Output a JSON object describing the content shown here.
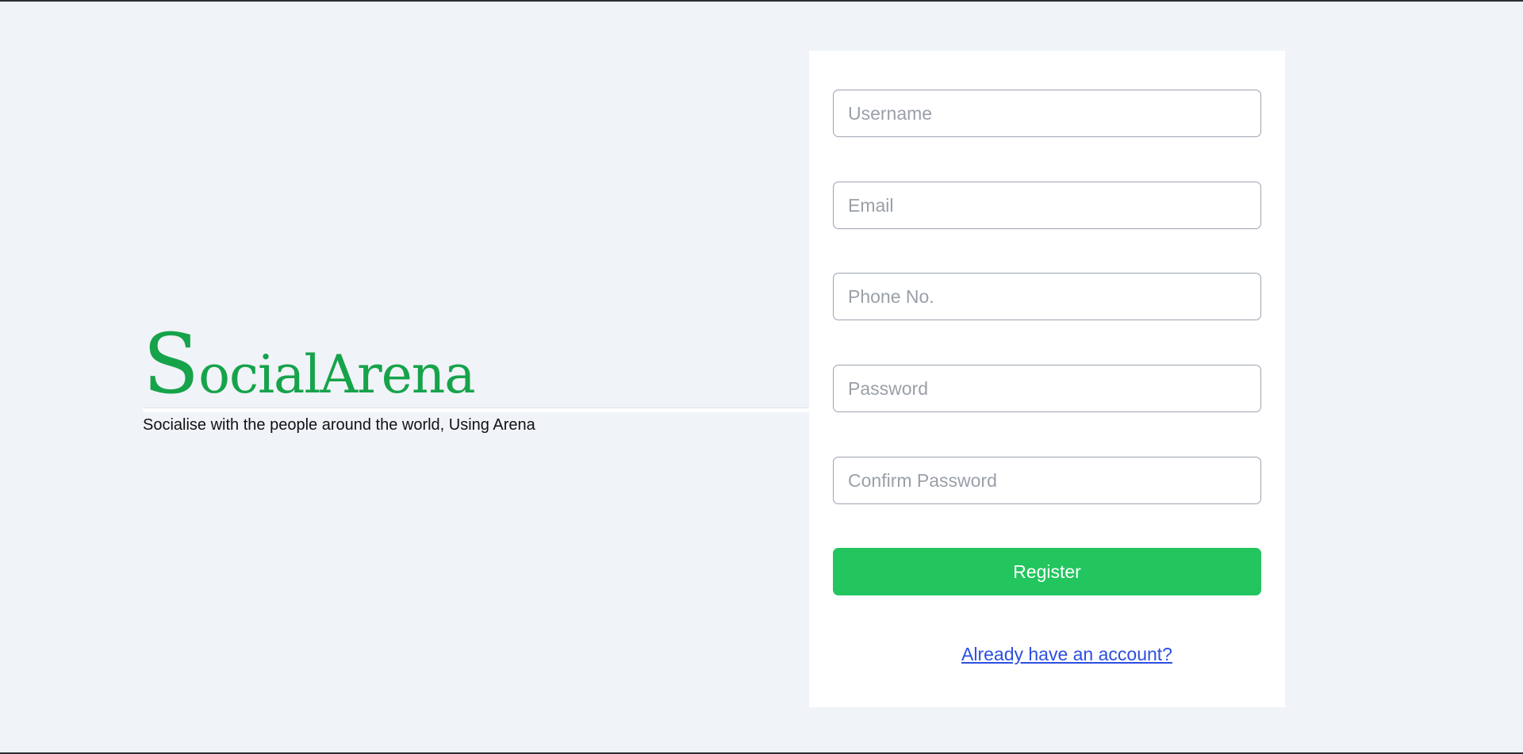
{
  "brand": {
    "initial": "S",
    "rest": "ocialArena",
    "tagline": "Socialise with the people around the world, Using Arena"
  },
  "form": {
    "username_placeholder": "Username",
    "email_placeholder": "Email",
    "phone_placeholder": "Phone No.",
    "password_placeholder": "Password",
    "confirm_password_placeholder": "Confirm Password",
    "register_label": "Register",
    "login_link": "Already have an account?"
  },
  "colors": {
    "brand_green": "#16a34a",
    "button_green": "#22c55e",
    "link_blue": "#2d4fe0",
    "background": "#f0f3f8"
  }
}
